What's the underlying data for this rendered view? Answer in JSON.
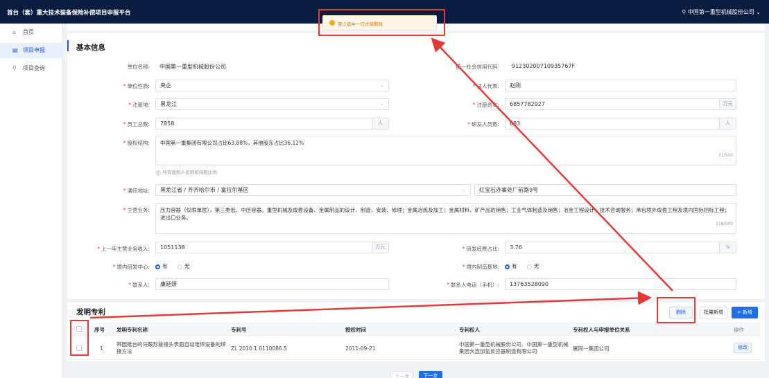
{
  "header": {
    "title": "首台（套）重大技术装备保险补偿项目申报平台",
    "user": "中国第一重型机械股份公司"
  },
  "sidebar": {
    "items": [
      {
        "label": "首页",
        "icon": "home-icon"
      },
      {
        "label": "项目申报",
        "icon": "document-icon"
      },
      {
        "label": "项目查询",
        "icon": "search-icon"
      }
    ]
  },
  "toast": {
    "message": "至少选中一行才能删除",
    "icon": "warning-icon"
  },
  "basic": {
    "title": "基本信息",
    "unit_name_label": "单位名称:",
    "unit_name": "中国第一重型机械股份公司",
    "credit_code_label": "统一社会信用代码:",
    "credit_code": "91230200710935767F",
    "unit_type_label": "单位性质:",
    "unit_type": "央企",
    "legal_rep_label": "法人代表:",
    "legal_rep": "赵刚",
    "reg_place_label": "注册地:",
    "reg_place": "黑龙江",
    "reg_capital_label": "注册资本:",
    "reg_capital": "6857782927",
    "reg_capital_unit": "万元",
    "employees_label": "员工总数:",
    "employees": "7858",
    "employees_unit": "人",
    "rd_staff_label": "研发人员数:",
    "rd_staff": "683",
    "rd_staff_unit": "人",
    "equity_label": "股权结构:",
    "equity": "中国第一重集团有限公司占比63.88%，其他股东占比36.12%",
    "equity_counter": "31/500",
    "equity_note": "注: 所有股权人名称和持股比例",
    "address_label": "通讯地址:",
    "address_region": "黑龙江省 / 齐齐哈尔市 / 富拉尔基区",
    "address_detail": "红宝石办事处厂前路9号",
    "business_label": "主营业务:",
    "business": "压力容器（仅限单层），第三类低、中压容器。重型机械及成套设备、金属制品的设计、制造、安装、修理；金属冶炼及加工；金属材料、矿产品的销售；工业气体制造及销售；冶金工程设计；技术咨询服务；承包境外成套工程及境内国际招标工程；进出口业务。",
    "business_counter": "116/500",
    "revenue_label": "上一年主营业务收入:",
    "revenue": "1051138",
    "revenue_unit": "万元",
    "rd_ratio_label": "研发经费占比:",
    "rd_ratio": "3.76",
    "rd_ratio_unit": "%",
    "rd_center_label": "境内研发中心:",
    "rd_center_yes": "有",
    "rd_center_no": "无",
    "mfg_base_label": "境内制造基地:",
    "mfg_base_yes": "有",
    "mfg_base_no": "无",
    "contact_label": "联系人:",
    "contact": "康延妍",
    "phone_label": "联系人电话（手机）:",
    "phone": "13763528090"
  },
  "patents": {
    "title": "发明专利",
    "delete_btn": "删除",
    "batch_btn": "批量新增",
    "add_btn": "+ 新增",
    "columns": [
      "序号",
      "发明专利名称",
      "专利号",
      "授权时间",
      "专利权人",
      "专利权人与申报单位关系",
      "操作"
    ],
    "rows": [
      {
        "no": "1",
        "name": "带圆锥台的马鞍形管接头表面自动堆焊设备的焊接方法",
        "number": "ZL 2010 1 0110086.5",
        "date": "2011-09-21",
        "owner": "中国第一重型机械股份公司、中国第一重型机械集团大连加氢反应器制造有限公司",
        "relation": "属同一集团公司",
        "action": "修改"
      }
    ]
  },
  "pager": {
    "prev": "上一步",
    "next": "下一步"
  },
  "colors": {
    "accent": "#1d5ad9",
    "header_bg": "#0a1b40",
    "annotation": "#e53935",
    "warning": "#f5a623"
  }
}
